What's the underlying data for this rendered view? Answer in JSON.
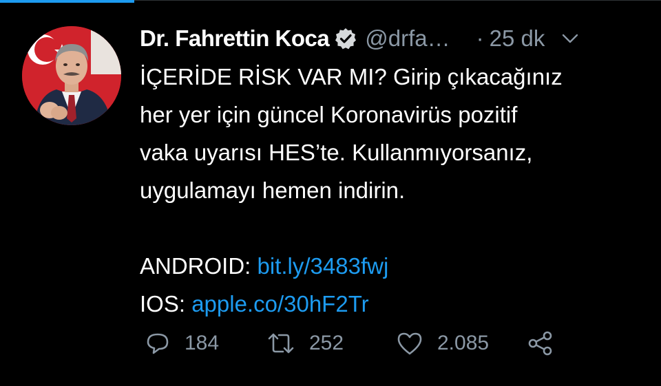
{
  "tweet": {
    "author": {
      "display_name": "Dr. Fahrettin Koca",
      "handle": "@drfa…",
      "verified": true
    },
    "separator": "·",
    "time": "25 dk",
    "lines": [
      "İÇERİDE RİSK VAR MI? Girip çıkacağınız",
      "her yer için güncel Koronavirüs pozitif",
      "vaka uyarısı HES’te. Kullanmıyorsanız,",
      "uygulamayı hemen indirin."
    ],
    "android": {
      "label": "ANDROID: ",
      "link": "bit.ly/3483fwj"
    },
    "ios": {
      "label": "IOS: ",
      "link": "apple.co/30hF2Tr"
    },
    "stats": {
      "replies": "184",
      "retweets": "252",
      "likes": "2.085"
    }
  },
  "colors": {
    "background": "#000000",
    "text": "#ffffff",
    "secondary": "#8b98a5",
    "link": "#1d9bf0"
  },
  "icons": {
    "verified": "verified-badge-icon",
    "more": "chevron-down-icon",
    "reply": "reply-icon",
    "retweet": "retweet-icon",
    "like": "heart-icon",
    "share": "share-icon"
  }
}
